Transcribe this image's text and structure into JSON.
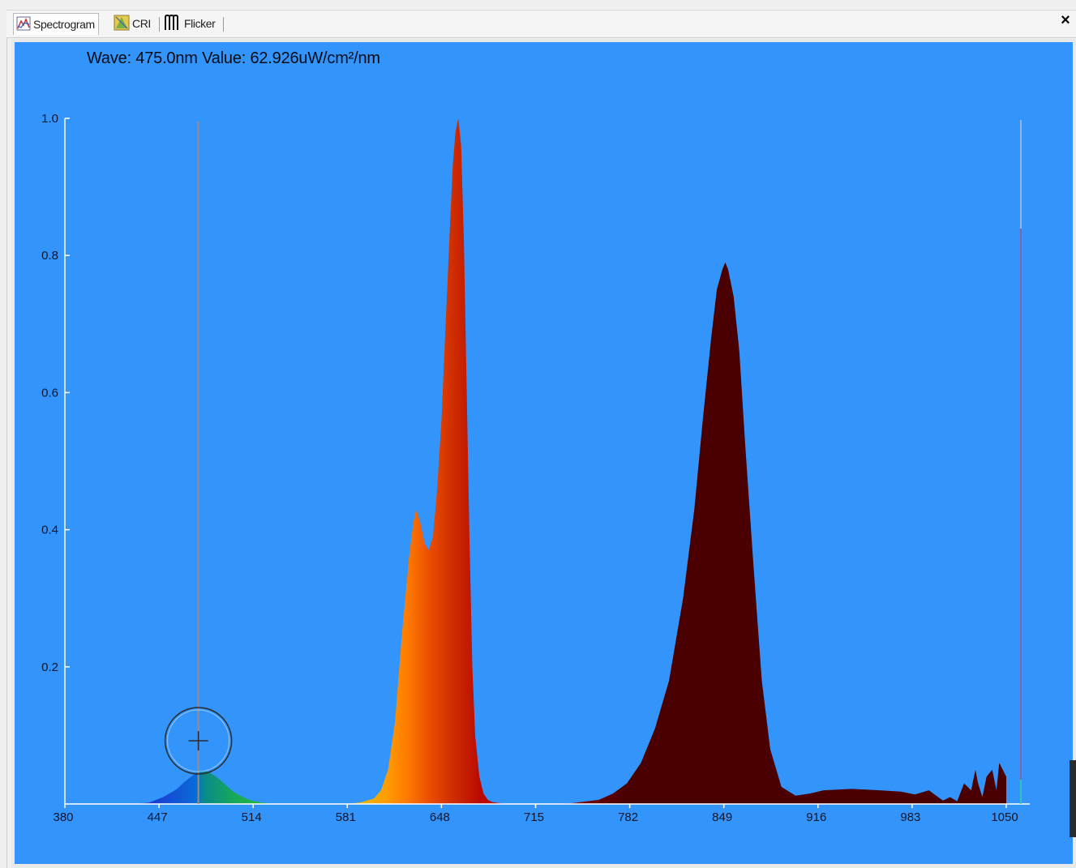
{
  "window": {
    "tabs": [
      {
        "label": "Spectrogram",
        "icon": "spectrogram-icon",
        "active": true
      },
      {
        "label": "CRI",
        "icon": "cri-icon",
        "active": false
      },
      {
        "label": "Flicker",
        "icon": "flicker-icon",
        "active": false
      }
    ],
    "close_label": "×"
  },
  "readout": {
    "text": "Wave: 475.0nm Value: 62.926uW/cm²/nm",
    "cursor_wavelength": 475.0
  },
  "colors": {
    "plot_background": "#3395fb",
    "axis": "#ffffff",
    "cursor_line": "#8f8f8f",
    "far_red_fill": "#4a0000"
  },
  "chart_data": {
    "type": "area",
    "title": "",
    "xlabel": "",
    "ylabel": "",
    "xlim": [
      380,
      1050
    ],
    "ylim": [
      0,
      1.0
    ],
    "x_ticks": [
      380,
      447,
      514,
      581,
      648,
      715,
      782,
      849,
      916,
      983,
      1050
    ],
    "y_ticks": [
      0.2,
      0.4,
      0.6,
      0.8,
      1.0
    ],
    "y_tick_labels": [
      "0.2",
      "0.4",
      "0.6",
      "0.8",
      "1.0"
    ],
    "grid": false,
    "series": [
      {
        "x": [
          380,
          430,
          440,
          450,
          460,
          465,
          470,
          474,
          478,
          482,
          486,
          490,
          495,
          500,
          505,
          510,
          515,
          520,
          525,
          530,
          540,
          560,
          580,
          590,
          600,
          605,
          610,
          615,
          620,
          625,
          628,
          630,
          633,
          636,
          639,
          642,
          645,
          648,
          651,
          654,
          656,
          658,
          660,
          662,
          664,
          666,
          668,
          670,
          672,
          675,
          678,
          681,
          684,
          690,
          700,
          710,
          720,
          740,
          760,
          770,
          780,
          790,
          800,
          810,
          820,
          828,
          834,
          840,
          844,
          848,
          850,
          852,
          856,
          860,
          864,
          870,
          876,
          882,
          890,
          900,
          910,
          920,
          940,
          960,
          975,
          985,
          995,
          1000,
          1005,
          1010,
          1015,
          1020,
          1025,
          1028,
          1030,
          1033,
          1036,
          1040,
          1043,
          1045,
          1050
        ],
        "values": [
          0,
          0.0,
          0.002,
          0.01,
          0.022,
          0.032,
          0.04,
          0.046,
          0.049,
          0.047,
          0.042,
          0.036,
          0.027,
          0.018,
          0.012,
          0.007,
          0.004,
          0.002,
          0.001,
          0.0,
          0.0,
          0.0,
          0.0,
          0.002,
          0.008,
          0.02,
          0.05,
          0.12,
          0.25,
          0.36,
          0.41,
          0.43,
          0.41,
          0.38,
          0.37,
          0.39,
          0.46,
          0.56,
          0.7,
          0.84,
          0.93,
          0.98,
          1.0,
          0.96,
          0.82,
          0.6,
          0.38,
          0.2,
          0.1,
          0.04,
          0.015,
          0.006,
          0.003,
          0.001,
          0.0,
          0.0,
          0.0,
          0.001,
          0.006,
          0.015,
          0.03,
          0.06,
          0.11,
          0.18,
          0.3,
          0.43,
          0.56,
          0.68,
          0.75,
          0.78,
          0.79,
          0.78,
          0.74,
          0.66,
          0.53,
          0.35,
          0.18,
          0.08,
          0.025,
          0.012,
          0.015,
          0.02,
          0.022,
          0.02,
          0.018,
          0.014,
          0.02,
          0.012,
          0.005,
          0.01,
          0.004,
          0.03,
          0.02,
          0.05,
          0.03,
          0.01,
          0.04,
          0.05,
          0.02,
          0.06,
          0.04
        ]
      }
    ],
    "cursor_x": 475.0
  }
}
